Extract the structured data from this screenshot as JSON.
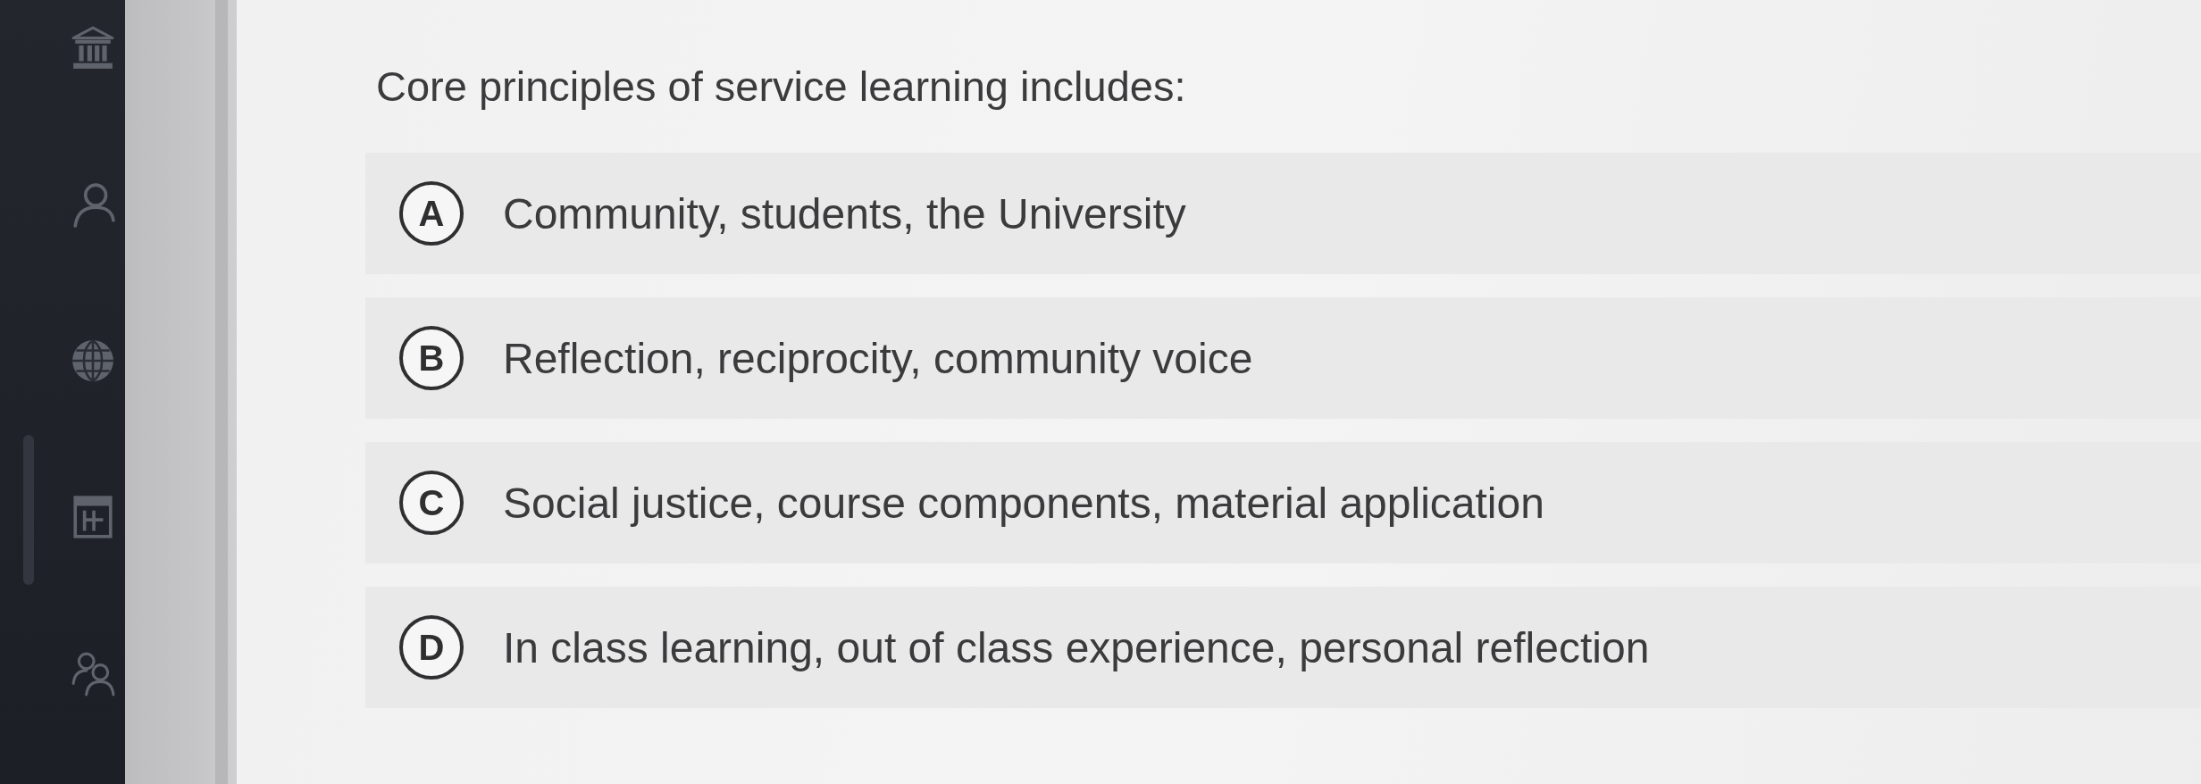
{
  "question": {
    "text": "Core principles of service learning includes:"
  },
  "options": [
    {
      "letter": "A",
      "text": "Community, students, the University",
      "selected": false
    },
    {
      "letter": "B",
      "text": "Reflection, reciprocity, community voice",
      "selected": false
    },
    {
      "letter": "C",
      "text": "Social justice, course components, material application",
      "selected": false
    },
    {
      "letter": "D",
      "text": "In class learning, out of class experience, personal reflection",
      "selected": false
    }
  ]
}
